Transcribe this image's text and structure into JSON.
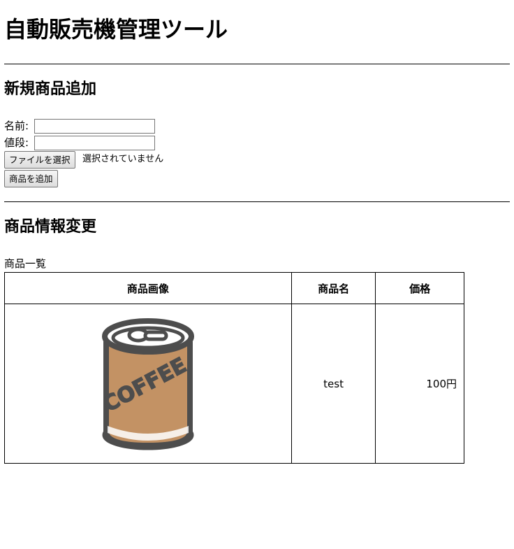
{
  "header": {
    "title": "自動販売機管理ツール"
  },
  "add_section": {
    "heading": "新規商品追加",
    "name_label": "名前:",
    "name_value": "",
    "price_label": "値段:",
    "price_value": "",
    "file_button_label": "ファイルを選択",
    "file_status": "選択されていません",
    "submit_label": "商品を追加"
  },
  "edit_section": {
    "heading": "商品情報変更",
    "table_caption": "商品一覧",
    "columns": [
      "商品画像",
      "商品名",
      "価格"
    ],
    "rows": [
      {
        "image_icon": "coffee-can-icon",
        "image_text": "COFFEE",
        "name": "test",
        "price": "100円"
      }
    ]
  },
  "colors": {
    "can_body": "#c39264",
    "can_outline": "#4d4d4d",
    "can_top": "#ffffff"
  }
}
